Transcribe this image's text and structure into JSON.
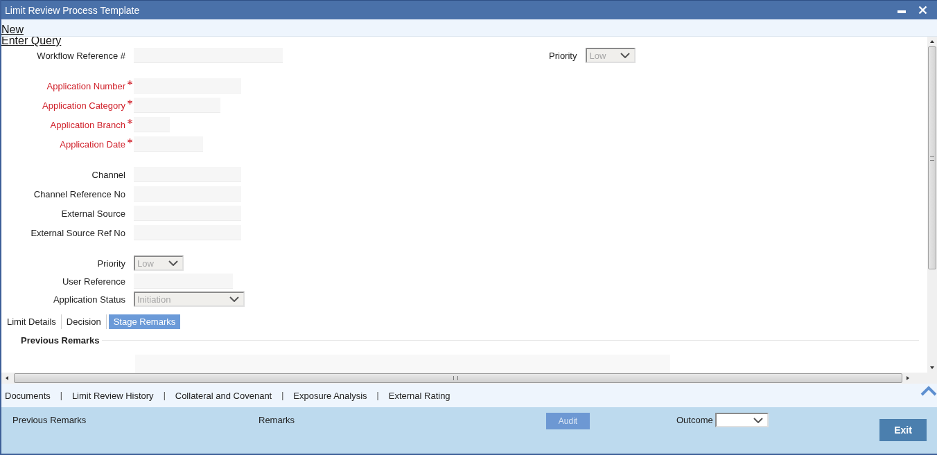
{
  "window": {
    "title": "Limit Review Process Template"
  },
  "toolbar": [
    {
      "label": "New"
    },
    {
      "label": "Enter Query"
    }
  ],
  "form": {
    "groups": [
      {
        "fields": [
          {
            "label": "Workflow Reference #",
            "kind": "text",
            "required": false
          }
        ]
      },
      {
        "fields": [
          {
            "label": "Application Number",
            "kind": "text",
            "required": true
          },
          {
            "label": "Application Category",
            "kind": "text",
            "required": true
          },
          {
            "label": "Application Branch",
            "kind": "text",
            "required": true
          },
          {
            "label": "Application Date",
            "kind": "text",
            "required": true
          }
        ]
      },
      {
        "fields": [
          {
            "label": "Channel",
            "kind": "text",
            "required": false
          },
          {
            "label": "Channel Reference No",
            "kind": "text",
            "required": false
          },
          {
            "label": "External Source",
            "kind": "text",
            "required": false
          },
          {
            "label": "External Source Ref No",
            "kind": "text",
            "required": false
          }
        ]
      },
      {
        "fields": [
          {
            "label": "Priority",
            "kind": "select",
            "required": false,
            "value": "Low",
            "disabled": true
          },
          {
            "label": "User Reference",
            "kind": "text",
            "required": false
          },
          {
            "label": "Application Status",
            "kind": "select",
            "required": false,
            "value": "Initiation",
            "disabled": true
          }
        ]
      }
    ],
    "side_field": {
      "label": "Priority",
      "kind": "select",
      "value": "Low",
      "disabled": true
    }
  },
  "tabs": [
    {
      "label": "Limit Details",
      "selected": false
    },
    {
      "label": "Decision",
      "selected": false
    },
    {
      "label": "Stage Remarks",
      "selected": true
    }
  ],
  "section": {
    "title": "Previous Remarks"
  },
  "links": [
    {
      "kind": "link",
      "label": "Documents"
    },
    {
      "kind": "separator",
      "label": "|"
    },
    {
      "kind": "link",
      "label": "Limit Review History"
    },
    {
      "kind": "separator",
      "label": "|"
    },
    {
      "kind": "link",
      "label": "Collateral and Covenant"
    },
    {
      "kind": "separator",
      "label": "|"
    },
    {
      "kind": "link",
      "label": "Exposure Analysis"
    },
    {
      "kind": "separator",
      "label": "|"
    },
    {
      "kind": "link",
      "label": "External Rating"
    }
  ],
  "footer": {
    "previous_remarks": "Previous Remarks",
    "remarks": "Remarks",
    "audit": {
      "label": "Audit",
      "disabled": true
    },
    "outcome": {
      "label": "Outcome"
    },
    "exit": "Exit"
  }
}
